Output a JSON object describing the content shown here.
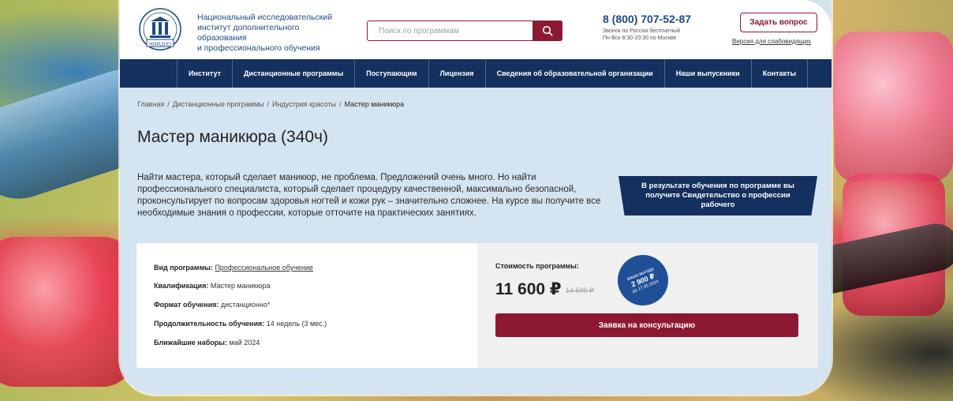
{
  "header": {
    "org_name_lines": [
      "Национальный исследовательский",
      "институт дополнительного образования",
      "и профессионального обучения"
    ],
    "logo_text": "НИИДПО",
    "search_placeholder": "Поиск по программам",
    "phone": "8 (800) 707-52-87",
    "phone_note_lines": [
      "Звонок по России бесплатный",
      "Пн-Вск 8:30-20:30 по Москве"
    ],
    "ask_button": "Задать вопрос",
    "low_vision_link": "Версия для слабовидящих"
  },
  "nav": {
    "items": [
      "Институт",
      "Дистанционные программы",
      "Поступающим",
      "Лицензия",
      "Сведения об образовательной организации",
      "Наши выпускники",
      "Контакты"
    ]
  },
  "breadcrumb": [
    "Главная",
    "Дистанционные программы",
    "Индустрия красоты",
    "Мастер маникюра"
  ],
  "page_title": "Мастер маникюра (340ч)",
  "description": "Найти мастера, который сделает маникюр, не проблема. Предложений очень много. Но найти профессионального специалиста, который сделает процедуру качественной, максимально безопасной, проконсультирует по вопросам здоровья ногтей и кожи рук – значительно сложнее. На курсе вы получите все необходимые знания о профессии, которые отточите на практических занятиях.",
  "ribbon_text": "В результате обучения по программе вы получите Свидетельство о профессии рабочего",
  "program_info": {
    "type_label": "Вид программы:",
    "type_value": "Профессиональное обучение",
    "qualification_label": "Квалификация:",
    "qualification_value": "Мастер маникюра",
    "format_label": "Формат обучения:",
    "format_value": "дистанционно*",
    "duration_label": "Продолжительность обучения:",
    "duration_value": "14 недель (3 мес.)",
    "enrollment_label": "Ближайшие наборы:",
    "enrollment_value": "май 2024"
  },
  "pricing": {
    "cost_label": "Стоимость программы:",
    "price": "11 600 ₽",
    "old_price": "14 500 ₽",
    "badge_top": "ваша выгода",
    "badge_amount": "2 900 ₽",
    "badge_date": "до 17.05.2024",
    "consult_button": "Заявка на консультацию"
  },
  "colors": {
    "navy": "#14305e",
    "burgundy": "#8c1832",
    "card_bg": "#d4e4f1",
    "badge_blue": "#1f4f97"
  }
}
